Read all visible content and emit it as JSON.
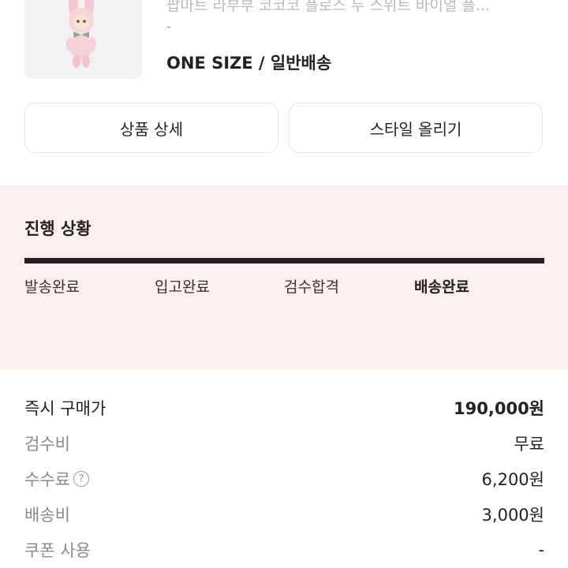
{
  "product": {
    "name": "팝마트 라부부 코코코 플로스 두 스위트 바이얼 플...",
    "dash": "-",
    "option": "ONE SIZE / 일반배송",
    "image_icon": "plush-doll-image"
  },
  "actions": {
    "detail_label": "상품 상세",
    "style_label": "스타일 올리기"
  },
  "progress": {
    "title": "진행 상황",
    "steps": [
      "발송완료",
      "입고완료",
      "검수합격",
      "배송완료"
    ],
    "current_index": 3,
    "completion": 1.0
  },
  "price": {
    "rows": [
      {
        "label": "즉시 구매가",
        "value": "190,000원"
      },
      {
        "label": "검수비",
        "value": "무료"
      },
      {
        "label": "수수료",
        "value": "6,200원"
      },
      {
        "label": "배송비",
        "value": "3,000원"
      },
      {
        "label": "쿠폰 사용",
        "value": "-"
      }
    ],
    "help_icon_text": "?"
  },
  "colors": {
    "progress_bg": "#fbf0ee",
    "progress_bar": "#222222",
    "thumb_bg": "#f2f2f4"
  }
}
